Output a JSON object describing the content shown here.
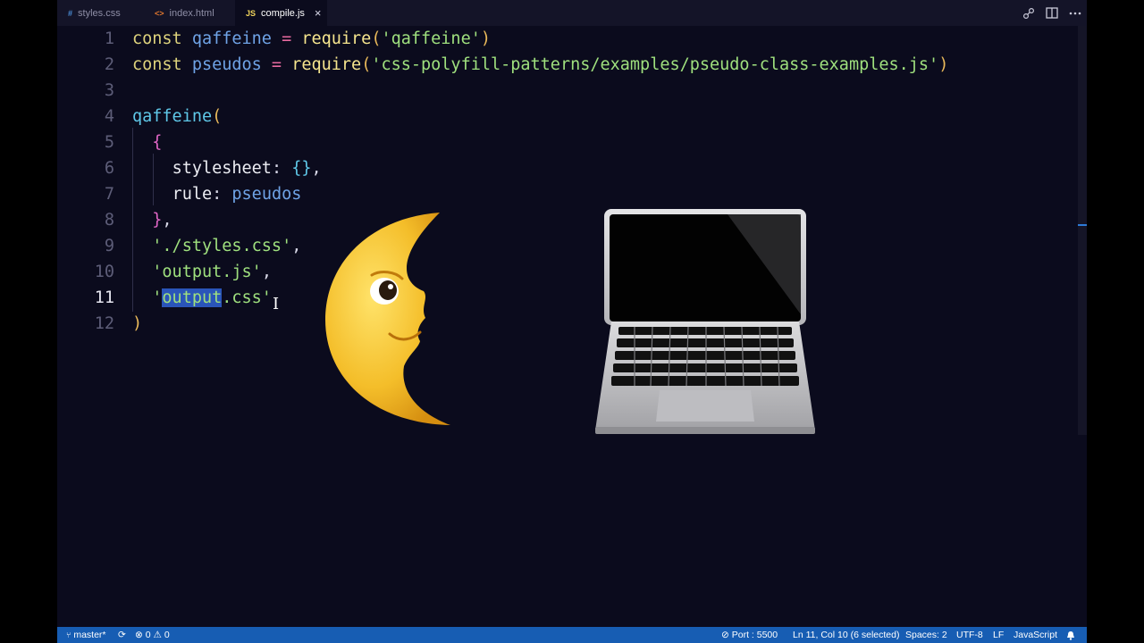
{
  "tabs": [
    {
      "icon": "#",
      "icon_color": "#4b8fd9",
      "label": "styles.css",
      "active": false
    },
    {
      "icon": "<>",
      "icon_color": "#e0762e",
      "label": "index.html",
      "active": false
    },
    {
      "icon": "JS",
      "icon_color": "#f0d45b",
      "label": "compile.js",
      "active": true,
      "close": "×"
    }
  ],
  "editor": {
    "current_line": 11,
    "lines": [
      {
        "n": "1",
        "tokens": [
          [
            "const ",
            "kw"
          ],
          [
            "qaffeine",
            "var"
          ],
          [
            " = ",
            "op"
          ],
          [
            "require",
            "fn"
          ],
          [
            "(",
            "brk"
          ],
          [
            "'qaffeine'",
            "str"
          ],
          [
            ")",
            "brk"
          ]
        ]
      },
      {
        "n": "2",
        "tokens": [
          [
            "const ",
            "kw"
          ],
          [
            "pseudos",
            "var"
          ],
          [
            " = ",
            "op"
          ],
          [
            "require",
            "fn"
          ],
          [
            "(",
            "brk"
          ],
          [
            "'css-polyfill-patterns/examples/pseudo-class-examples.js'",
            "str"
          ],
          [
            ")",
            "brk"
          ]
        ]
      },
      {
        "n": "3",
        "tokens": []
      },
      {
        "n": "4",
        "tokens": [
          [
            "qaffeine",
            "call"
          ],
          [
            "(",
            "brk"
          ]
        ]
      },
      {
        "n": "5",
        "tokens": [
          [
            "  ",
            "pun"
          ],
          [
            "{",
            "brc"
          ]
        ]
      },
      {
        "n": "6",
        "tokens": [
          [
            "    ",
            "pun"
          ],
          [
            "stylesheet",
            "prop"
          ],
          [
            ": ",
            "pun"
          ],
          [
            "{}",
            "call"
          ],
          [
            ",",
            "pun"
          ]
        ]
      },
      {
        "n": "7",
        "tokens": [
          [
            "    ",
            "pun"
          ],
          [
            "rule",
            "prop"
          ],
          [
            ": ",
            "pun"
          ],
          [
            "pseudos",
            "var"
          ]
        ]
      },
      {
        "n": "8",
        "tokens": [
          [
            "  ",
            "pun"
          ],
          [
            "}",
            "brc"
          ],
          [
            ",",
            "pun"
          ]
        ]
      },
      {
        "n": "9",
        "tokens": [
          [
            "  ",
            "pun"
          ],
          [
            "'./styles.css'",
            "str"
          ],
          [
            ",",
            "pun"
          ]
        ]
      },
      {
        "n": "10",
        "tokens": [
          [
            "  ",
            "pun"
          ],
          [
            "'",
            "str"
          ],
          [
            "output",
            "str"
          ],
          [
            ".js'",
            "str"
          ],
          [
            ",",
            "pun"
          ]
        ]
      },
      {
        "n": "11",
        "tokens": [
          [
            "  ",
            "pun"
          ],
          [
            "'",
            "str"
          ],
          [
            "output",
            "str sel"
          ],
          [
            ".css'",
            "str"
          ]
        ]
      },
      {
        "n": "12",
        "tokens": [
          [
            ")",
            "brk"
          ]
        ]
      }
    ]
  },
  "emoji": {
    "moon": "🌜",
    "laptop": "💻"
  },
  "statusbar": {
    "branch": "master*",
    "sync": "⟳",
    "errors": "0",
    "warnings": "0",
    "port": "Port : 5500",
    "position": "Ln 11, Col 10 (6 selected)",
    "spaces": "Spaces: 2",
    "encoding": "UTF-8",
    "eol": "LF",
    "language": "JavaScript"
  }
}
